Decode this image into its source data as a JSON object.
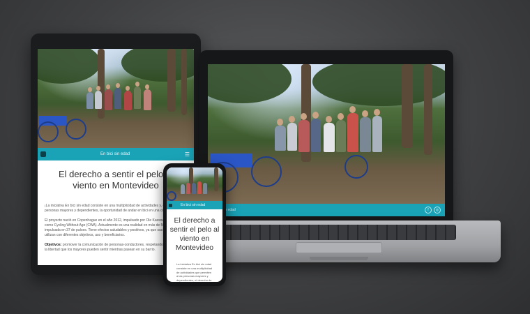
{
  "site": {
    "brand": "En bici sin edad",
    "title": "El derecho a sentir el pelo al viento en Montevideo",
    "laptop_brand": "Sin edad",
    "laptop_nav": [
      "",
      "",
      ""
    ]
  },
  "tablet": {
    "paragraphs": [
      "¡La iniciativa En bici sin edad consiste en una multiplicidad de actividades y, en cuanto a las personas mayores y dependientes, la oportunidad de andar en bici en una ciudad.",
      "El proyecto nació en Copenhague en el año 2012, impulsado por Ole Kassow, conocida como Cycling Without Age (CWA). Actualmente es una realidad en más de 50 países, impulsada en 37 de países. Tiene efectos saludables y positivos, ya que sus bicis se utilizan con diferentes objetivos, uso y beneficiarios."
    ],
    "objective_label": "Objetivos:",
    "objective_text": "promover la comunicación de personas-conductores, respetando por su edad, la libertad que los mayores pueden sentir mientras pasean en su barrio."
  },
  "phone": {
    "paragraph": "La iniciativa En bici sin edad consiste en una multiplicidad de actividades que permiten a las personas mayores y dependientes, el derecho de andar en bici."
  },
  "colors": {
    "accent": "#1aa3b7",
    "background": "#3f4042"
  },
  "icons": [
    "menu-icon",
    "facebook-icon",
    "instagram-icon",
    "logo-icon"
  ]
}
